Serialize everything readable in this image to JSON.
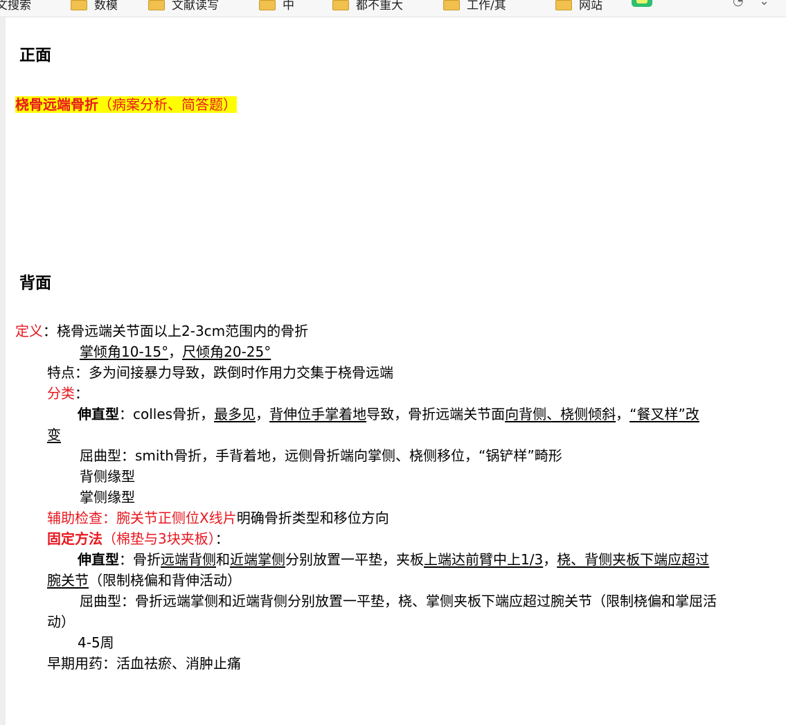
{
  "bookmarks": [
    {
      "label": "文搜索",
      "folder": false
    },
    {
      "label": "数模",
      "folder": true
    },
    {
      "label": "文献读写",
      "folder": true
    },
    {
      "label": "中",
      "folder": true
    },
    {
      "label": "都不重大",
      "folder": true
    },
    {
      "label": "工作/其",
      "folder": true
    },
    {
      "label": "网站",
      "folder": true
    }
  ],
  "front": {
    "heading": "正面",
    "title": "桡骨远端骨折",
    "title_note": "（病案分析、简答题）"
  },
  "back": {
    "heading": "背面",
    "def_label": "定义",
    "def_sep": "：",
    "def_text": "桡骨远端关节面以上2-3cm范围内的骨折",
    "angles": {
      "palmar": "掌倾角10-15°",
      "sep": "，",
      "ulnar": "尺倾角20-25°"
    },
    "features": "特点：多为间接暴力导致，跌倒时作用力交集于桡骨远端",
    "class_label": "分类",
    "class_sep": "：",
    "ext": {
      "label": "伸直型",
      "p1": "：colles骨折，",
      "u1": "最多见",
      "p2": "，",
      "u2": "背伸位手掌着地",
      "p3": "导致，骨折远端关节面",
      "u3": "向背侧、桡侧倾斜",
      "p4": "，",
      "u4a": "“餐叉样”改",
      "u4b": "变"
    },
    "flex": "屈曲型：smith骨折，手背着地，远侧骨折端向掌侧、桡侧移位，“锅铲样”畸形",
    "dorsal_rim": "背侧缘型",
    "palmar_rim": "掌侧缘型",
    "aux": {
      "label": "辅助检查：",
      "red": "腕关节正侧位X线片",
      "text": "明确骨折类型和移位方向"
    },
    "fix": {
      "label": "固定方法",
      "note": "（棉垫与3块夹板）",
      "sep": "："
    },
    "fix_ext": {
      "label": "伸直型",
      "p1": "：骨折",
      "u1": "远端背侧",
      "p2": "和",
      "u2": "近端掌侧",
      "p3": "分别放置一平垫，夹板",
      "u3": "上端达前臂中上1/3",
      "p4": "，",
      "u4a": "桡、背侧夹板下端应超过",
      "u4b": "腕关节",
      "p5": "（限制桡偏和背伸活动）"
    },
    "fix_flex_a": "屈曲型：骨折远端掌侧和近端背侧分别放置一平垫，桡、掌侧夹板下端应超过腕关节（限制桡偏和掌屈活",
    "fix_flex_b": "动）",
    "duration": "4-5周",
    "early_med": "早期用药：活血祛瘀、消肿止痛"
  }
}
